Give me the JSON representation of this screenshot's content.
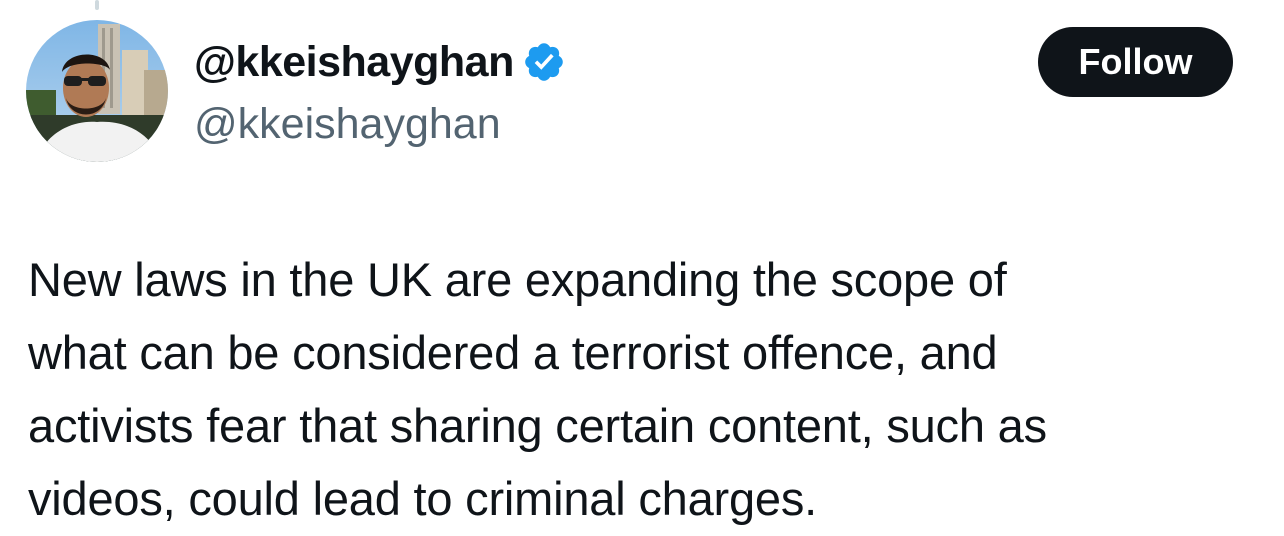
{
  "tweet": {
    "author": {
      "display_name": "@kkeishayghan",
      "handle": "@kkeishayghan",
      "verified": true,
      "verified_icon": "verified-badge-icon",
      "avatar_icon": "profile-photo"
    },
    "follow_label": "Follow",
    "text": "New laws in the UK are expanding the scope of\nwhat can be considered a terrorist offence, and\nactivists fear that sharing certain content, such as\nvideos, could lead to criminal charges."
  },
  "colors": {
    "text": "#0f1419",
    "secondary_text": "#536471",
    "verified_blue": "#1d9bf0",
    "button_bg": "#0f1419",
    "button_text": "#ffffff"
  }
}
